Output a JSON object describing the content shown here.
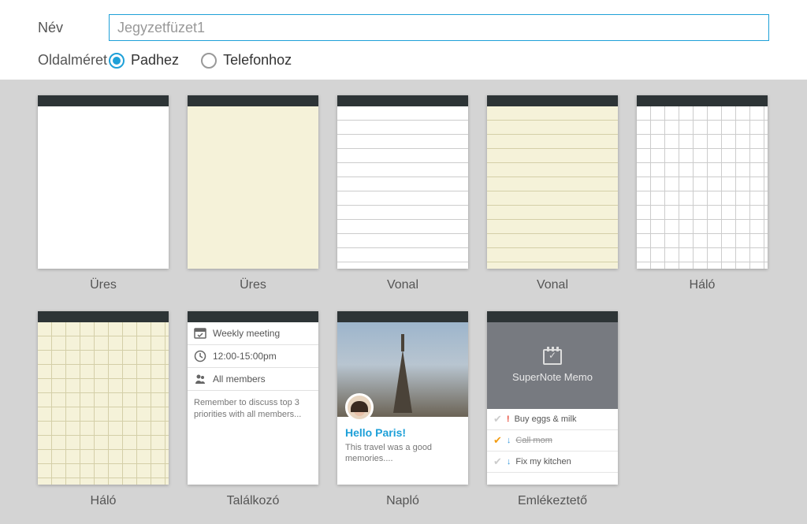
{
  "form": {
    "name_label": "Név",
    "name_placeholder": "Jegyzetfüzet1",
    "size_label": "Oldalméret",
    "radio_pad": "Padhez",
    "radio_phone": "Telefonhoz"
  },
  "templates": [
    {
      "caption": "Üres"
    },
    {
      "caption": "Üres"
    },
    {
      "caption": "Vonal"
    },
    {
      "caption": "Vonal"
    },
    {
      "caption": "Háló"
    },
    {
      "caption": "Háló"
    },
    {
      "caption": "Találkozó"
    },
    {
      "caption": "Napló"
    },
    {
      "caption": "Emlékeztető"
    }
  ],
  "meeting": {
    "title": "Weekly meeting",
    "time": "12:00-15:00pm",
    "attendees": "All members",
    "notes": "Remember to discuss top 3 priorities with all members..."
  },
  "diary": {
    "title": "Hello Paris!",
    "body": "This travel was a good memories...."
  },
  "memo": {
    "title": "SuperNote Memo",
    "items": [
      {
        "done": false,
        "priority": "high",
        "text": "Buy eggs & milk"
      },
      {
        "done": true,
        "priority": "low",
        "text": "Call mom"
      },
      {
        "done": false,
        "priority": "low",
        "text": "Fix my kitchen"
      }
    ]
  }
}
